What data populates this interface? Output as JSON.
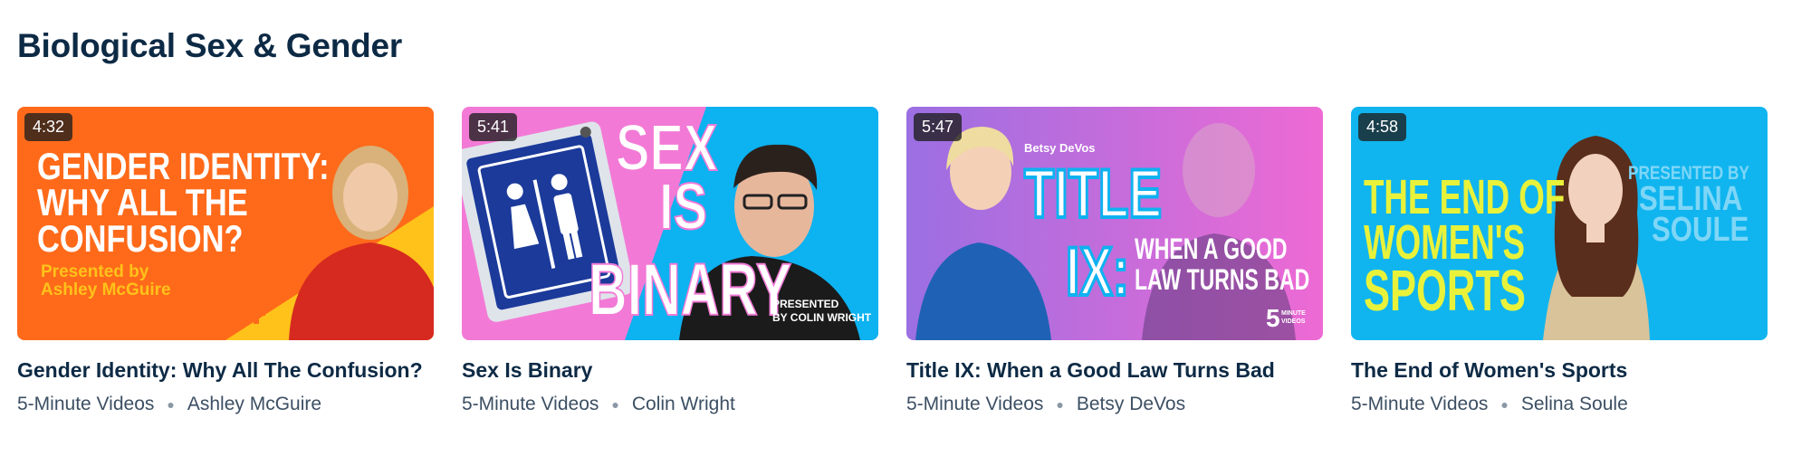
{
  "section": {
    "title": "Biological Sex & Gender"
  },
  "videos": [
    {
      "duration": "4:32",
      "title": "Gender Identity: Why All The Confusion?",
      "channel": "5-Minute Videos",
      "presenter": "Ashley McGuire",
      "thumb": {
        "headline_lines": [
          "GENDER IDENTITY:",
          "WHY ALL THE",
          "CONFUSION?"
        ],
        "presented_lines": [
          "Presented by",
          "Ashley McGuire"
        ],
        "bg_color": "#ff6a1a",
        "accent_color": "#ffc21a"
      }
    },
    {
      "duration": "5:41",
      "title": "Sex Is Binary",
      "channel": "5-Minute Videos",
      "presenter": "Colin Wright",
      "thumb": {
        "headline_lines": [
          "SEX",
          "IS",
          "BINARY"
        ],
        "presented_lines": [
          "PRESENTED",
          "BY COLIN WRIGHT"
        ],
        "bg_color": "#f27ad6",
        "accent_color": "#0db2f0"
      }
    },
    {
      "duration": "5:47",
      "title": "Title IX: When a Good Law Turns Bad",
      "channel": "5-Minute Videos",
      "presenter": "Betsy DeVos",
      "thumb": {
        "name_tag": "Betsy DeVos",
        "headline_lines": [
          "TITLE",
          "IX:"
        ],
        "sub_lines": [
          "WHEN A GOOD",
          "LAW TURNS BAD"
        ],
        "logo_number": "5",
        "logo_text": [
          "MINUTE",
          "VIDEOS"
        ],
        "bg_color": "#a36ae0",
        "accent_color": "#e56ad8"
      }
    },
    {
      "duration": "4:58",
      "title": "The End of Women's Sports",
      "channel": "5-Minute Videos",
      "presenter": "Selina Soule",
      "thumb": {
        "headline_lines": [
          "THE END OF",
          "WOMEN'S",
          "SPORTS"
        ],
        "presented_lines": [
          "PRESENTED BY",
          "SELINA",
          "SOULE"
        ],
        "bg_color": "#10b5ef",
        "accent_color": "#e8f23a"
      }
    }
  ]
}
